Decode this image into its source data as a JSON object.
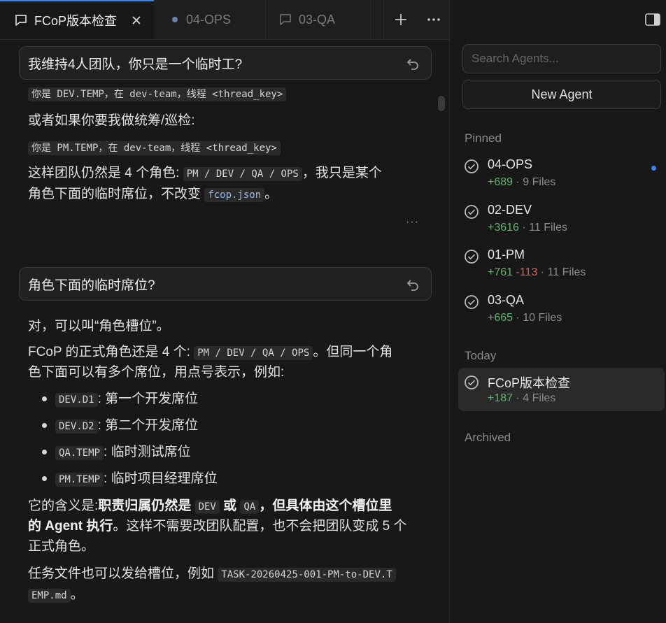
{
  "tabs": [
    {
      "label": "FCoP版本检查",
      "icon": "chat-icon",
      "active": true
    },
    {
      "label": "04-OPS",
      "icon": "dot-icon",
      "active": false
    },
    {
      "label": "03-QA",
      "icon": "chat-icon",
      "active": false
    }
  ],
  "chat": {
    "msg1": {
      "user": "我维持4人团队，你只是一个临时工?",
      "code_line1": "你是 DEV.TEMP，在 dev-team，线程 <thread_key>",
      "text1": "或者如果你要我做统筹/巡检:",
      "code_line2": "你是 PM.TEMP，在 dev-team，线程 <thread_key>",
      "text2a": "这样团队仍然是 4 个角色:",
      "code_roles": "PM / DEV / QA / OPS",
      "text2b": "，我只是某个",
      "text3a": "角色下面的临时席位，不改变",
      "code_config": "fcop.json",
      "text3b": "。"
    },
    "msg2": {
      "user": "角色下面的临时席位?",
      "p1": "对，可以叫“角色槽位”。",
      "p2a": "FCoP 的正式角色还是 4 个:",
      "p2_code": "PM / DEV / QA / OPS",
      "p2b": "。但同一个角",
      "p2c": "色下面可以有多个席位，用点号表示，例如:",
      "slots": [
        {
          "code": "DEV.D1",
          "text": ": 第一个开发席位"
        },
        {
          "code": "DEV.D2",
          "text": ": 第二个开发席位"
        },
        {
          "code": "QA.TEMP",
          "text": ": 临时测试席位"
        },
        {
          "code": "PM.TEMP",
          "text": ": 临时项目经理席位"
        }
      ],
      "p3a": "它的含义是:",
      "p3b": "职责归属仍然是",
      "p3_code1": "DEV",
      "p3c": "或",
      "p3_code2": "QA",
      "p3d": "，但具体由这个槽位里",
      "p3e": "的 Agent 执行",
      "p3f": "。这样不需要改团队配置，也不会把团队变成 5 个",
      "p3g": "正式角色。",
      "p4a": "任务文件也可以发给槽位，例如",
      "p4_code1": "TASK-20260425-001-PM-to-DEV.T",
      "p4_code2": "EMP.md",
      "p4b": "。"
    }
  },
  "sidebar": {
    "search_placeholder": "Search Agents...",
    "new_agent": "New Agent",
    "pinned_title": "Pinned",
    "today_title": "Today",
    "archived_title": "Archived",
    "pinned": [
      {
        "name": "04-OPS",
        "added": "+689",
        "removed": "",
        "files": "9 Files",
        "unread": true
      },
      {
        "name": "02-DEV",
        "added": "+3616",
        "removed": "",
        "files": "11 Files",
        "unread": false
      },
      {
        "name": "01-PM",
        "added": "+761",
        "removed": "-113",
        "files": "11 Files",
        "unread": false
      },
      {
        "name": "03-QA",
        "added": "+665",
        "removed": "",
        "files": "10 Files",
        "unread": false
      }
    ],
    "today": [
      {
        "name": "FCoP版本检查",
        "added": "+187",
        "removed": "",
        "files": "4 Files",
        "selected": true
      }
    ],
    "sep": "·"
  },
  "colors": {
    "accent": "#3b82f6",
    "added": "#5fb46f",
    "removed": "#e05d5d",
    "background": "#181818"
  }
}
